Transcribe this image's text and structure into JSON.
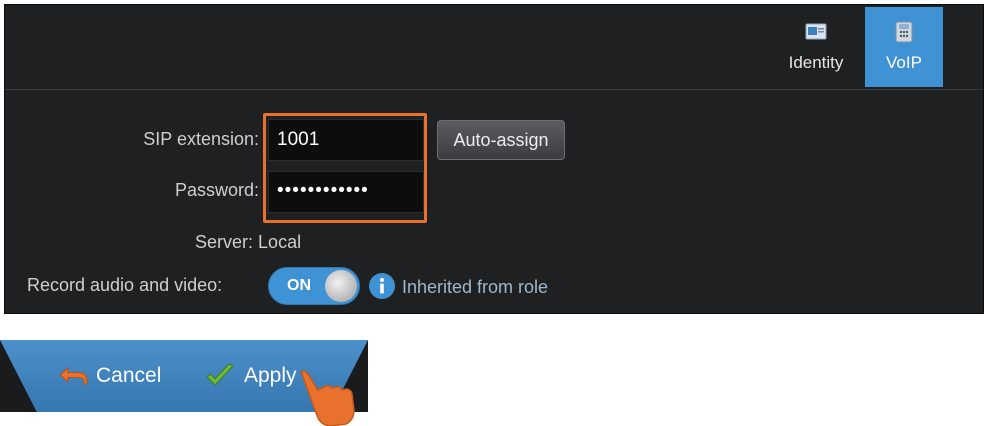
{
  "tabs": [
    {
      "label": "Identity",
      "icon": "id-card-icon",
      "active": false
    },
    {
      "label": "VoIP",
      "icon": "phone-icon",
      "active": true
    }
  ],
  "form": {
    "sip_label": "SIP extension:",
    "sip_value": "1001",
    "auto_assign_label": "Auto-assign",
    "password_label": "Password:",
    "password_value": "••••••••••••",
    "server_label": "Server:",
    "server_value": "Local",
    "record_label": "Record audio and video:",
    "record_toggle": "ON",
    "inherited_text": "Inherited from role"
  },
  "actions": {
    "cancel_label": "Cancel",
    "apply_label": "Apply"
  },
  "colors": {
    "accent": "#3f93d4",
    "highlight": "#e8712d",
    "panel": "#1f2022"
  }
}
